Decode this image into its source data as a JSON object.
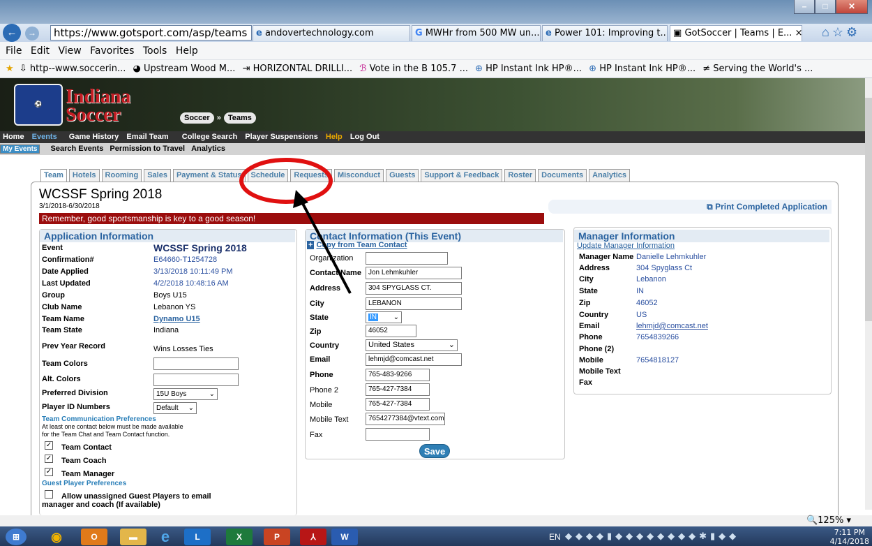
{
  "browser": {
    "url": "https://www.gotsport.com/asp/teams",
    "tabs": [
      {
        "label": "andovertechnology.com"
      },
      {
        "label": "MWHr from 500 MW un..."
      },
      {
        "label": "Power 101: Improving t..."
      },
      {
        "label": "GotSoccer | Teams | E...",
        "close": "×"
      }
    ],
    "menu": [
      "File",
      "Edit",
      "View",
      "Favorites",
      "Tools",
      "Help"
    ],
    "favorites": [
      "http--www.soccerin...",
      "Upstream Wood M...",
      "HORIZONTAL DRILLI...",
      "Vote in the B 105.7 ...",
      "HP Instant Ink HP®...",
      "HP Instant Ink HP®...",
      "Serving the World's ..."
    ],
    "zoom": "125%"
  },
  "banner": {
    "brand_line1": "Indiana",
    "brand_line2": "Soccer",
    "crumb1": "Soccer",
    "crumb_sep": "»",
    "crumb2": "Teams"
  },
  "mainnav": [
    "Home",
    "Events",
    "Game History",
    "Email Team",
    "College Search",
    "Player Suspensions",
    "Help",
    "Log Out"
  ],
  "subnav": [
    "My Events",
    "Search Events",
    "Permission to Travel",
    "Analytics"
  ],
  "pagetabs": [
    "Team",
    "Hotels",
    "Rooming",
    "Sales",
    "Payment & Status",
    "Schedule",
    "Requests",
    "Misconduct",
    "Guests",
    "Support & Feedback",
    "Roster",
    "Documents",
    "Analytics"
  ],
  "event": {
    "title": "WCSSF Spring 2018",
    "dates": "3/1/2018-6/30/2018",
    "print": "Print Completed Application",
    "reminder": "Remember, good sportsmanship is key to a good season!"
  },
  "application": {
    "heading": "Application Information",
    "rows": [
      {
        "label": "Event",
        "value": "WCSSF Spring 2018"
      },
      {
        "label": "Confirmation#",
        "value": "E64660-T1254728"
      },
      {
        "label": "Date Applied",
        "value": "3/13/2018 10:11:49 PM"
      },
      {
        "label": "Last Updated",
        "value": "4/2/2018 10:48:16 AM"
      },
      {
        "label": "Group",
        "value": "Boys U15"
      },
      {
        "label": "Club Name",
        "value": "Lebanon YS"
      },
      {
        "label": "Team Name",
        "value": "Dynamo U15"
      },
      {
        "label": "Team State",
        "value": "Indiana"
      }
    ],
    "prev_record_label": "Prev Year Record",
    "prev_record_value": "Wins Losses Ties",
    "team_colors_label": "Team Colors",
    "alt_colors_label": "Alt. Colors",
    "pref_division_label": "Preferred Division",
    "pref_division_value": "15U Boys",
    "player_id_label": "Player ID Numbers",
    "player_id_value": "Default",
    "comm_heading": "Team Communication Preferences",
    "comm_note1": "At least one contact below must be made available",
    "comm_note2": "for the Team Chat and Team Contact function.",
    "checks": [
      "Team Contact",
      "Team Coach",
      "Team Manager"
    ],
    "guest_heading": "Guest Player Preferences",
    "guest_option1": "Allow unassigned Guest Players to email",
    "guest_option2": "manager and coach (If available)"
  },
  "contact": {
    "heading": "Contact Information (This Event)",
    "copy_link": "Copy from Team Contact",
    "fields": [
      {
        "label": "Organization",
        "value": ""
      },
      {
        "label": "Contact Name",
        "value": "Jon Lehmkuhler"
      },
      {
        "label": "Address",
        "value": "304 SPYGLASS CT."
      },
      {
        "label": "City",
        "value": "LEBANON"
      },
      {
        "label": "State",
        "value": "IN"
      },
      {
        "label": "Zip",
        "value": "46052"
      },
      {
        "label": "Country",
        "value": "United States"
      },
      {
        "label": "Email",
        "value": "lehmjd@comcast.net"
      },
      {
        "label": "Phone",
        "value": "765-483-9266"
      },
      {
        "label": "Phone 2",
        "value": "765-427-7384"
      },
      {
        "label": "Mobile",
        "value": "765-427-7384"
      },
      {
        "label": "Mobile Text",
        "value": "7654277384@vtext.com"
      },
      {
        "label": "Fax",
        "value": ""
      }
    ],
    "save": "Save"
  },
  "manager": {
    "heading": "Manager Information",
    "update_link": "Update Manager Information",
    "rows": [
      {
        "label": "Manager Name",
        "value": "Danielle Lehmkuhler"
      },
      {
        "label": "Address",
        "value": "304 Spyglass Ct"
      },
      {
        "label": "City",
        "value": "Lebanon"
      },
      {
        "label": "State",
        "value": "IN"
      },
      {
        "label": "Zip",
        "value": "46052"
      },
      {
        "label": "Country",
        "value": "US"
      },
      {
        "label": "Email",
        "value": "lehmjd@comcast.net"
      },
      {
        "label": "Phone",
        "value": "7654839266"
      },
      {
        "label": "Phone (2)",
        "value": ""
      },
      {
        "label": "Mobile",
        "value": "7654818127"
      },
      {
        "label": "Mobile Text",
        "value": ""
      },
      {
        "label": "Fax",
        "value": ""
      }
    ]
  },
  "taskbar": {
    "lang": "EN",
    "time": "7:11 PM",
    "date": "4/14/2018"
  },
  "colors": {
    "accent": "#2a63a0",
    "reminder_bg": "#9b0d0d",
    "annotation_red": "#e01010"
  }
}
